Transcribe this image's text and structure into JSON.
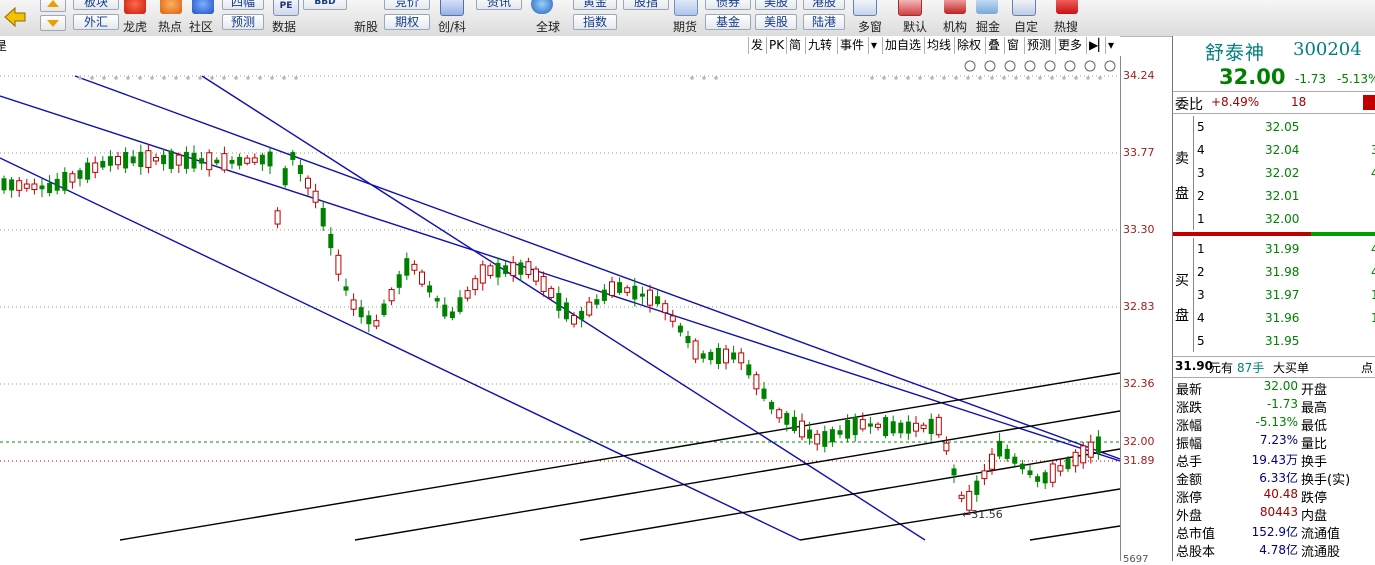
{
  "toolbar": {
    "cut_buttons": [
      "板块",
      "四幅",
      "竞价",
      "资讯",
      "黄金",
      "股指",
      "债券",
      "美股",
      "港股"
    ],
    "low_buttons": [
      "外汇",
      "预测",
      "期权",
      "指数",
      "基金",
      "美股",
      "陆港"
    ],
    "labels": [
      "龙虎",
      "热点",
      "社区",
      "数据",
      "新股",
      "创/科",
      "全球",
      "期货",
      "多窗",
      "默认",
      "机构",
      "掘金",
      "自定",
      "热搜"
    ],
    "data_icon_text": "PE",
    "bbd_text": "BBD"
  },
  "chart_tabs": [
    "发",
    "PK",
    "简",
    "九转",
    "事件",
    "加自选",
    "均线",
    "除权",
    "叠",
    "窗",
    "预测",
    "更多"
  ],
  "left_edge_char": "昰",
  "price_axis": [
    "34.24",
    "33.77",
    "33.30",
    "32.83",
    "32.36",
    "32.00",
    "31.89"
  ],
  "bottom_axis_value": "5697",
  "low_annotation": "←31.56",
  "stock": {
    "name": "舒泰神",
    "code": "300204",
    "price": "32.00",
    "change": "-1.73",
    "change_pct": "-5.13%"
  },
  "weibi": {
    "label": "委比",
    "value": "+8.49%",
    "count": "18"
  },
  "sell_label": [
    "卖",
    "盘"
  ],
  "buy_label": [
    "买",
    "盘"
  ],
  "sell_orders": [
    {
      "level": "5",
      "price": "32.05",
      "vol": ""
    },
    {
      "level": "4",
      "price": "32.04",
      "vol": "3"
    },
    {
      "level": "3",
      "price": "32.02",
      "vol": "4"
    },
    {
      "level": "2",
      "price": "32.01",
      "vol": ""
    },
    {
      "level": "1",
      "price": "32.00",
      "vol": ""
    }
  ],
  "buy_orders": [
    {
      "level": "1",
      "price": "31.99",
      "vol": "4"
    },
    {
      "level": "2",
      "price": "31.98",
      "vol": "4"
    },
    {
      "level": "3",
      "price": "31.97",
      "vol": "1"
    },
    {
      "level": "4",
      "price": "31.96",
      "vol": "1"
    },
    {
      "level": "5",
      "price": "31.95",
      "vol": ""
    }
  ],
  "big_order": {
    "price": "31.90",
    "unit": "元有",
    "qty": "87手",
    "label": "大买单",
    "tail": "点"
  },
  "stats": [
    {
      "l1": "最新",
      "v1": "32.00",
      "c1": "#008000",
      "l2": "开盘"
    },
    {
      "l1": "涨跌",
      "v1": "-1.73",
      "c1": "#008000",
      "l2": "最高"
    },
    {
      "l1": "涨幅",
      "v1": "-5.13%",
      "c1": "#008000",
      "l2": "最低"
    },
    {
      "l1": "振幅",
      "v1": "7.23%",
      "c1": "#000080",
      "l2": "量比"
    },
    {
      "l1": "总手",
      "v1": "19.43万",
      "c1": "#000080",
      "l2": "换手"
    },
    {
      "l1": "金额",
      "v1": "6.33亿",
      "c1": "#000080",
      "l2": "换手(实)"
    },
    {
      "l1": "涨停",
      "v1": "40.48",
      "c1": "#a00000",
      "l2": "跌停"
    },
    {
      "l1": "外盘",
      "v1": "80443",
      "c1": "#a00000",
      "l2": "内盘"
    },
    {
      "l1": "总市值",
      "v1": "152.9亿",
      "c1": "#000080",
      "l2": "流通值"
    },
    {
      "l1": "总股本",
      "v1": "4.78亿",
      "c1": "#000080",
      "l2": "流通股"
    }
  ],
  "colors": {
    "up": "#c00000",
    "down": "#008000",
    "channel_blue": "#1010b0",
    "channel_black": "#000000",
    "accent": "#008080"
  }
}
